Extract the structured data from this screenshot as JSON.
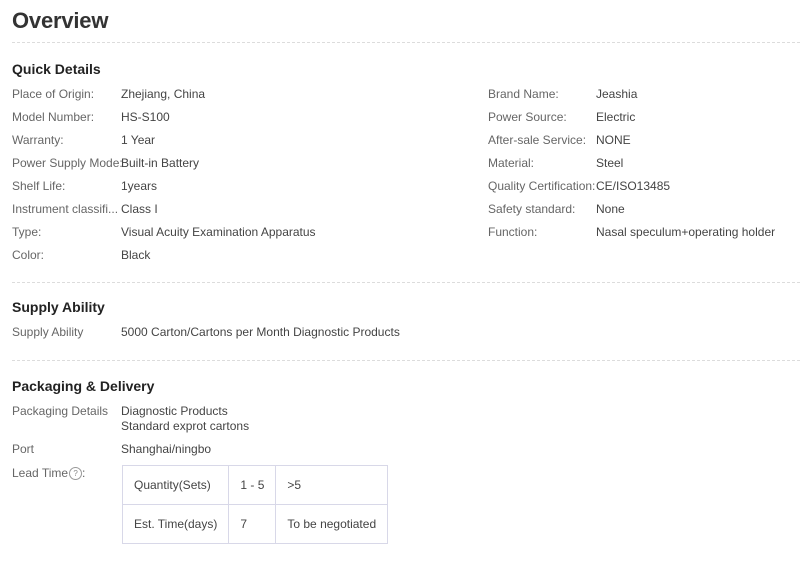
{
  "title": "Overview",
  "quick_details": {
    "heading": "Quick Details",
    "left": [
      {
        "label": "Place of Origin:",
        "value": "Zhejiang, China"
      },
      {
        "label": "Model Number:",
        "value": "HS-S100"
      },
      {
        "label": "Warranty:",
        "value": "1 Year"
      },
      {
        "label": "Power Supply Mode:",
        "value": "Built-in Battery"
      },
      {
        "label": "Shelf Life:",
        "value": "1years"
      },
      {
        "label": "Instrument classifi...",
        "value": "Class I"
      },
      {
        "label": "Type:",
        "value": "Visual Acuity Examination Apparatus"
      },
      {
        "label": "Color:",
        "value": "Black"
      }
    ],
    "right": [
      {
        "label": "Brand Name:",
        "value": "Jeashia"
      },
      {
        "label": "Power Source:",
        "value": "Electric"
      },
      {
        "label": "After-sale Service:",
        "value": "NONE"
      },
      {
        "label": "Material:",
        "value": "Steel"
      },
      {
        "label": "Quality Certification:",
        "value": "CE/ISO13485"
      },
      {
        "label": "Safety standard:",
        "value": "None"
      },
      {
        "label": "Function:",
        "value": "Nasal speculum+operating holder"
      }
    ]
  },
  "supply_ability": {
    "heading": "Supply Ability",
    "label": "Supply Ability",
    "value": "5000 Carton/Cartons per Month Diagnostic Products"
  },
  "packaging": {
    "heading": "Packaging & Delivery",
    "details_label": "Packaging Details",
    "details_line1": "Diagnostic Products",
    "details_line2": "Standard exprot cartons",
    "port_label": "Port",
    "port_value": "Shanghai/ningbo",
    "lead_time_label": "Lead Time",
    "lead_time_help": "?",
    "lead_time_suffix": ":",
    "lead_table": [
      [
        "Quantity(Sets)",
        "1 - 5",
        ">5"
      ],
      [
        "Est. Time(days)",
        "7",
        "To be negotiated"
      ]
    ]
  }
}
